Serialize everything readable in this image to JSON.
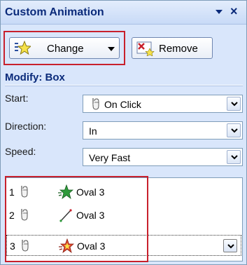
{
  "panel": {
    "title": "Custom Animation",
    "close_glyph": "×"
  },
  "toolbar": {
    "change_label": "Change",
    "remove_label": "Remove"
  },
  "modify": {
    "title": "Modify: Box",
    "start_label": "Start:",
    "start_value": "On Click",
    "direction_label": "Direction:",
    "direction_value": "In",
    "speed_label": "Speed:",
    "speed_value": "Very Fast"
  },
  "list": {
    "items": [
      {
        "num": "1",
        "name": "Oval 3",
        "effect_icon": "entrance-star-icon"
      },
      {
        "num": "2",
        "name": "Oval 3",
        "effect_icon": "motion-path-icon"
      },
      {
        "num": "3",
        "name": "Oval 3",
        "effect_icon": "exit-star-icon"
      }
    ]
  },
  "colors": {
    "highlight_red": "#c8202c",
    "title_blue": "#0a2a7a",
    "pane_bg": "#d9e6fb"
  }
}
